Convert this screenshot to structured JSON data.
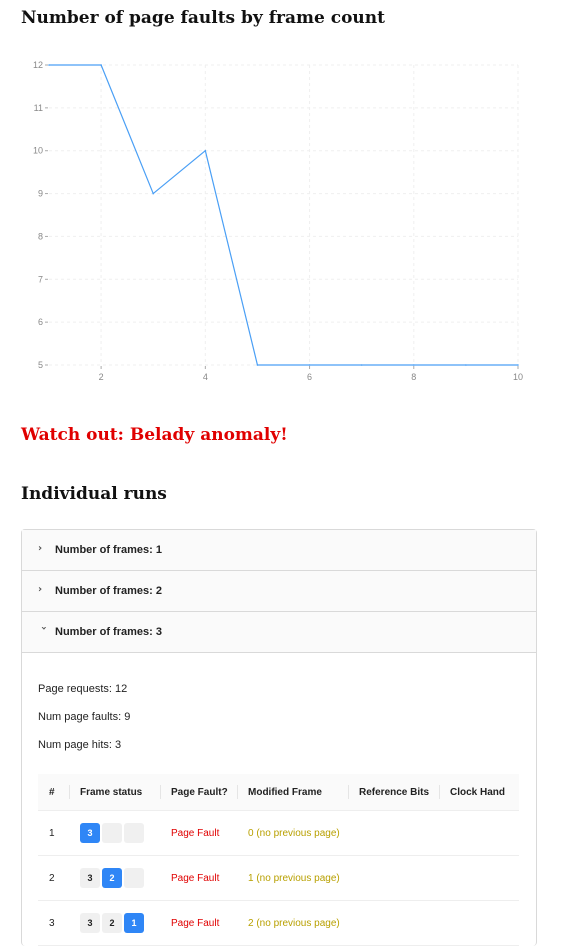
{
  "title": "Number of page faults by frame count",
  "chart_data": {
    "type": "line",
    "x": [
      1,
      2,
      3,
      4,
      5,
      6,
      7,
      8,
      9,
      10
    ],
    "series": [
      {
        "values": [
          12,
          12,
          9,
          10,
          5,
          5,
          5,
          5,
          5,
          5
        ],
        "color": "#4a9ff5"
      }
    ],
    "xticks": [
      2,
      4,
      6,
      8,
      10
    ],
    "yticks": [
      5,
      6,
      7,
      8,
      9,
      10,
      11,
      12
    ],
    "xlim": [
      1,
      10
    ],
    "ylim": [
      5,
      12
    ],
    "grid": true,
    "title": "",
    "xlabel": "",
    "ylabel": ""
  },
  "warning": "Watch out: Belady anomaly!",
  "runs_title": "Individual runs",
  "accordion": [
    {
      "label": "Number of frames: 1",
      "expanded": false
    },
    {
      "label": "Number of frames: 2",
      "expanded": false
    },
    {
      "label": "Number of frames: 3",
      "expanded": true
    }
  ],
  "stats": {
    "page_requests": "Page requests: 12",
    "num_faults": "Num page faults: 9",
    "num_hits": "Num page hits: 3"
  },
  "table": {
    "headers": [
      "#",
      "Frame status",
      "Page Fault?",
      "Modified Frame",
      "Reference Bits",
      "Clock Hand"
    ],
    "rows": [
      {
        "num": "1",
        "frames": [
          "3",
          "",
          ""
        ],
        "highlight": 0,
        "fault": "Page Fault",
        "modified": "0 (no previous page)"
      },
      {
        "num": "2",
        "frames": [
          "3",
          "2",
          ""
        ],
        "highlight": 1,
        "fault": "Page Fault",
        "modified": "1 (no previous page)"
      },
      {
        "num": "3",
        "frames": [
          "3",
          "2",
          "1"
        ],
        "highlight": 2,
        "fault": "Page Fault",
        "modified": "2 (no previous page)"
      }
    ]
  }
}
